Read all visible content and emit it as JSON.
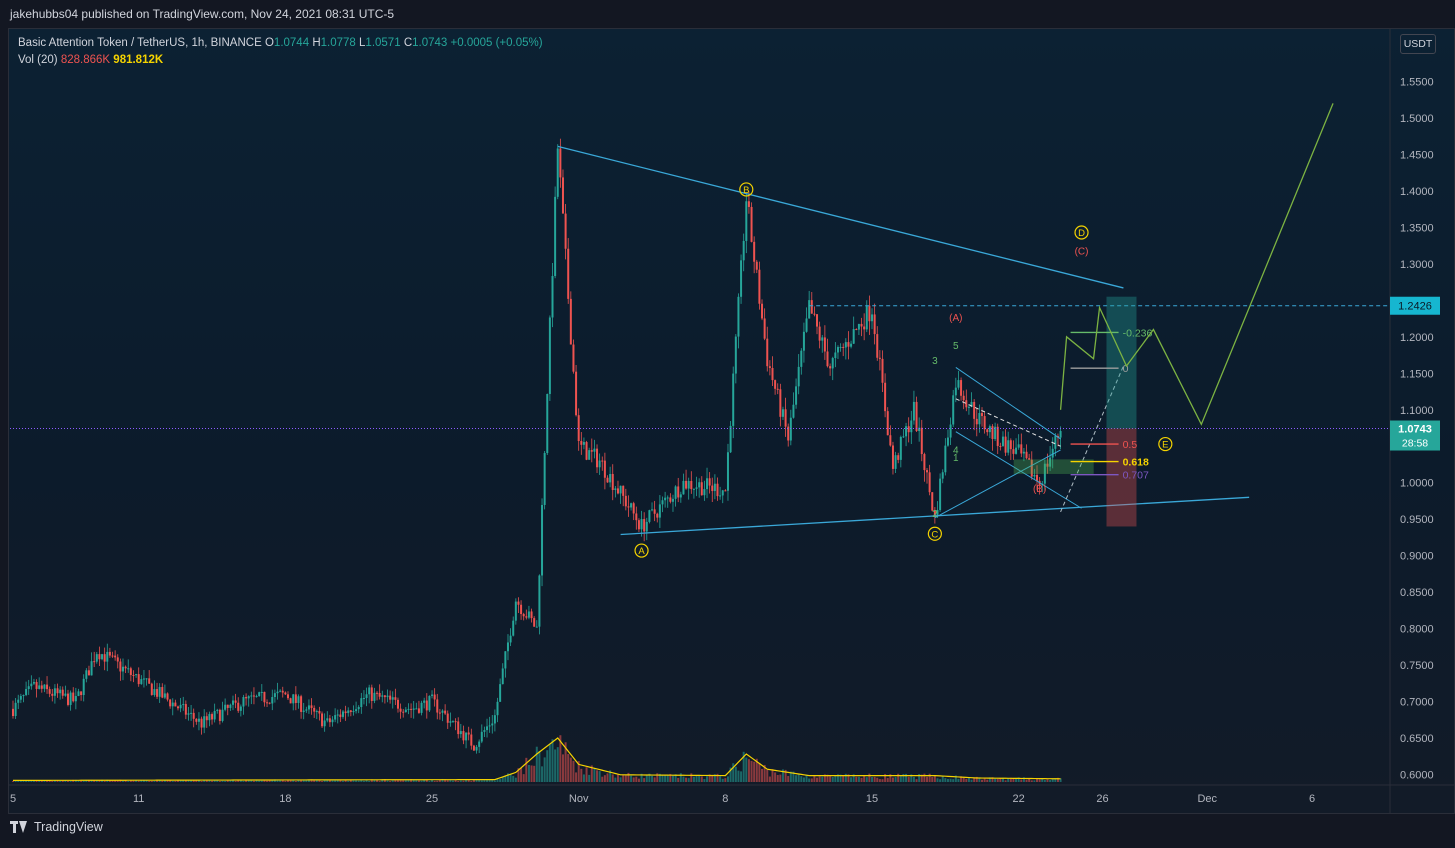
{
  "header": {
    "publisher_line": "jakehubbs04 published on TradingView.com, Nov 24, 2021 08:31 UTC-5"
  },
  "legend": {
    "symbol_line": "Basic Attention Token / TetherUS, 1h, BINANCE",
    "o_label": "O",
    "o_value": "1.0744",
    "h_label": "H",
    "h_value": "1.0778",
    "l_label": "L",
    "l_value": "1.0571",
    "c_label": "C",
    "c_value": "1.0743",
    "change": "+0.0005 (+0.05%)",
    "vol_label": "Vol (20)",
    "vol_value": "828.866K",
    "vol_ma_value": "981.812K"
  },
  "currency_button": "USDT",
  "footer": {
    "brand": "TradingView"
  },
  "colors": {
    "up": "#26a69a",
    "down": "#ef5350",
    "trendline": "#3aa8d8",
    "projection": "#7cb342",
    "wave_label": "#f5d300",
    "last_price": "#26a69a"
  },
  "chart_data": {
    "type": "candlestick",
    "interval": "1h",
    "ylim": [
      0.585,
      1.59
    ],
    "y_ticks": [
      "1.5500",
      "1.5000",
      "1.4500",
      "1.4000",
      "1.3500",
      "1.3000",
      "1.2500",
      "1.2000",
      "1.1500",
      "1.1000",
      "1.0500",
      "1.0000",
      "0.9500",
      "0.9000",
      "0.8500",
      "0.8000",
      "0.7500",
      "0.7000",
      "0.6500",
      "0.6000"
    ],
    "x_ticks": [
      "5",
      "11",
      "18",
      "25",
      "Nov",
      "8",
      "15",
      "22",
      "26",
      "Dec",
      "6"
    ],
    "price_path": [
      [
        "Oct 5",
        0.69
      ],
      [
        "Oct 6",
        0.72
      ],
      [
        "Oct 8",
        0.7
      ],
      [
        "Oct 9",
        0.77
      ],
      [
        "Oct 11",
        0.73
      ],
      [
        "Oct 14",
        0.67
      ],
      [
        "Oct 16",
        0.7
      ],
      [
        "Oct 18",
        0.71
      ],
      [
        "Oct 20",
        0.67
      ],
      [
        "Oct 22",
        0.71
      ],
      [
        "Oct 24",
        0.69
      ],
      [
        "Oct 25",
        0.7
      ],
      [
        "Oct 27",
        0.64
      ],
      [
        "Oct 28",
        0.68
      ],
      [
        "Oct 29",
        0.84
      ],
      [
        "Oct 30",
        0.8
      ],
      [
        "Oct 31",
        1.46
      ],
      [
        "Nov 1",
        1.05
      ],
      [
        "Nov 2",
        1.03
      ],
      [
        "Nov 4",
        0.94
      ],
      [
        "Nov 6",
        1.0
      ],
      [
        "Nov 8",
        0.99
      ],
      [
        "Nov 9",
        1.39
      ],
      [
        "Nov 10",
        1.17
      ],
      [
        "Nov 11",
        1.06
      ],
      [
        "Nov 12",
        1.24
      ],
      [
        "Nov 13",
        1.16
      ],
      [
        "Nov 15",
        1.24
      ],
      [
        "Nov 16",
        1.02
      ],
      [
        "Nov 17",
        1.1
      ],
      [
        "Nov 18",
        0.95
      ],
      [
        "Nov 19",
        1.14
      ],
      [
        "Nov 20",
        1.09
      ],
      [
        "Nov 21",
        1.06
      ],
      [
        "Nov 22",
        1.04
      ],
      [
        "Nov 23",
        1.0
      ],
      [
        "Nov 24",
        1.0743
      ]
    ],
    "volume_ma_path": [
      [
        "Oct 5",
        0.2
      ],
      [
        "Oct 28",
        0.3
      ],
      [
        "Oct 29",
        1.2
      ],
      [
        "Oct 30",
        3.5
      ],
      [
        "Oct 31",
        5.5
      ],
      [
        "Nov 1",
        2.2
      ],
      [
        "Nov 3",
        0.9
      ],
      [
        "Nov 8",
        0.8
      ],
      [
        "Nov 9",
        3.5
      ],
      [
        "Nov 10",
        1.6
      ],
      [
        "Nov 12",
        0.8
      ],
      [
        "Nov 18",
        0.8
      ],
      [
        "Nov 20",
        0.5
      ],
      [
        "Nov 24",
        0.4
      ]
    ],
    "last_price": "1.0743",
    "countdown": "28:58",
    "level_line": "1.2426",
    "trendlines": [
      {
        "from": [
          "Oct 31",
          1.461
        ],
        "to": [
          "Nov 27",
          1.267
        ]
      },
      {
        "from": [
          "Nov 3",
          0.929
        ],
        "to": [
          "Dec 3",
          0.98
        ]
      }
    ],
    "wave_labels": [
      {
        "text": "A",
        "at": [
          "Nov 4",
          0.907
        ]
      },
      {
        "text": "B",
        "at": [
          "Nov 9",
          1.402
        ]
      },
      {
        "text": "C",
        "at": [
          "Nov 18",
          0.93
        ]
      },
      {
        "text": "D",
        "at": [
          "Nov 25",
          1.343
        ]
      },
      {
        "text": "E",
        "at": [
          "Nov 29",
          1.053
        ]
      }
    ],
    "subwave_labels": [
      {
        "text": "(A)",
        "at": [
          "Nov 19",
          1.222
        ],
        "color": "red"
      },
      {
        "text": "(B)",
        "at": [
          "Nov 23",
          0.987
        ],
        "color": "red"
      },
      {
        "text": "(C)",
        "at": [
          "Nov 25",
          1.313
        ],
        "color": "red"
      },
      {
        "text": "1",
        "at": [
          "Nov 19",
          1.03
        ],
        "color": "green"
      },
      {
        "text": "2",
        "at": [
          "Nov 18",
          0.953
        ],
        "color": "green"
      },
      {
        "text": "3",
        "at": [
          "Nov 18",
          1.163
        ],
        "color": "green"
      },
      {
        "text": "4",
        "at": [
          "Nov 19",
          1.04
        ],
        "color": "green"
      },
      {
        "text": "5",
        "at": [
          "Nov 19",
          1.183
        ],
        "color": "green"
      }
    ],
    "fib_levels": [
      {
        "label": "-0.236",
        "value": 1.206,
        "color": "#66bb6a"
      },
      {
        "label": "0",
        "value": 1.157,
        "color": "#9e9e9e"
      },
      {
        "label": "0.5",
        "value": 1.053,
        "color": "#ef5350"
      },
      {
        "label": "0.618",
        "value": 1.029,
        "color": "#f5d300"
      },
      {
        "label": "0.707",
        "value": 1.011,
        "color": "#7e57c2"
      }
    ],
    "projection_path": [
      [
        "Nov 24",
        1.1
      ],
      [
        "Nov 24",
        1.2
      ],
      [
        "Nov 25",
        1.17
      ],
      [
        "Nov 25",
        1.24
      ],
      [
        "Nov 26",
        1.16
      ],
      [
        "Nov 27",
        1.21
      ],
      [
        "Nov 29",
        1.08
      ],
      [
        "Dec 5",
        1.52
      ]
    ]
  }
}
